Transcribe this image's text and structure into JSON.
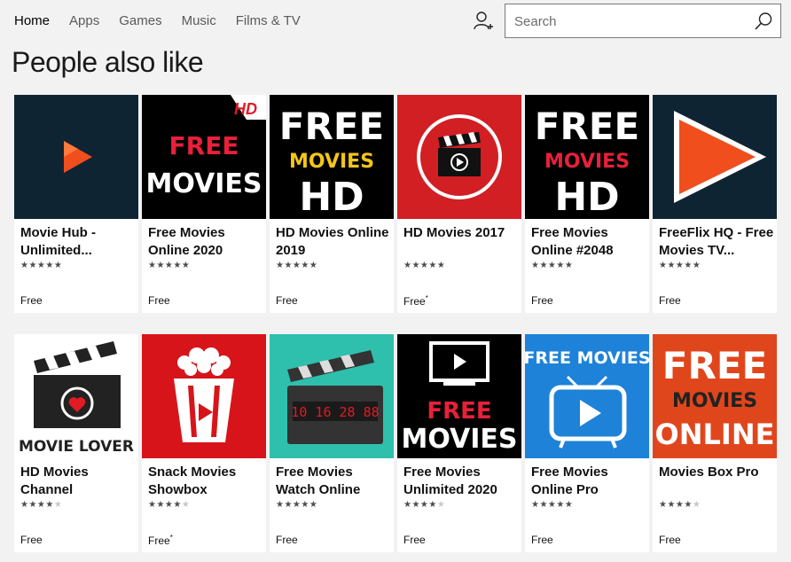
{
  "nav": {
    "items": [
      "Home",
      "Apps",
      "Games",
      "Music",
      "Films & TV"
    ],
    "active": "Home"
  },
  "search": {
    "placeholder": "Search"
  },
  "section": {
    "title": "People also like"
  },
  "apps_row1": [
    {
      "title": "Movie Hub - Unlimited...",
      "rating": 4.5,
      "price": "Free",
      "tile_text": ""
    },
    {
      "title": "Free Movies Online 2020",
      "rating": 4.5,
      "price": "Free",
      "tile_text": "FREE MOVIES",
      "badge": "HD"
    },
    {
      "title": "HD Movies Online 2019",
      "rating": 4.5,
      "price": "Free",
      "tile_text": "FREE MOVIES HD"
    },
    {
      "title": "HD Movies 2017",
      "rating": 4.5,
      "price": "Free",
      "price_mark": "*",
      "tile_text": ""
    },
    {
      "title": "Free Movies Online #2048",
      "rating": 4.5,
      "price": "Free",
      "tile_text": "FREE MOVIES HD"
    },
    {
      "title": "FreeFlix HQ - Free Movies TV...",
      "rating": 4.5,
      "price": "Free",
      "tile_text": ""
    }
  ],
  "apps_row2": [
    {
      "title": "HD Movies Channel",
      "rating": 4,
      "price": "Free",
      "tile_text": "MOVIE LOVER"
    },
    {
      "title": "Snack Movies Showbox",
      "rating": 4,
      "price": "Free",
      "price_mark": "*",
      "tile_text": ""
    },
    {
      "title": "Free Movies Watch Online",
      "rating": 5,
      "price": "Free",
      "tile_text": "10 16 28 88"
    },
    {
      "title": "Free Movies Unlimited 2020",
      "rating": 4,
      "price": "Free",
      "tile_text": "FREE MOVIES"
    },
    {
      "title": "Free Movies Online Pro",
      "rating": 4.5,
      "price": "Free",
      "tile_text": "FREE MOVIES"
    },
    {
      "title": "Movies Box Pro",
      "rating": 4,
      "price": "Free",
      "tile_text": "FREE MOVIES ONLINE"
    }
  ],
  "colors": {
    "background": "#f2f2f2",
    "card": "#ffffff",
    "tile_red": "#e01b24",
    "tile_dark": "#0f2433",
    "tile_orange": "#e0461c",
    "tile_blue": "#1e82d8",
    "tile_teal": "#2fbfad"
  },
  "icons": {
    "user": "add-user-icon",
    "search": "search-icon",
    "star": "star-icon"
  }
}
